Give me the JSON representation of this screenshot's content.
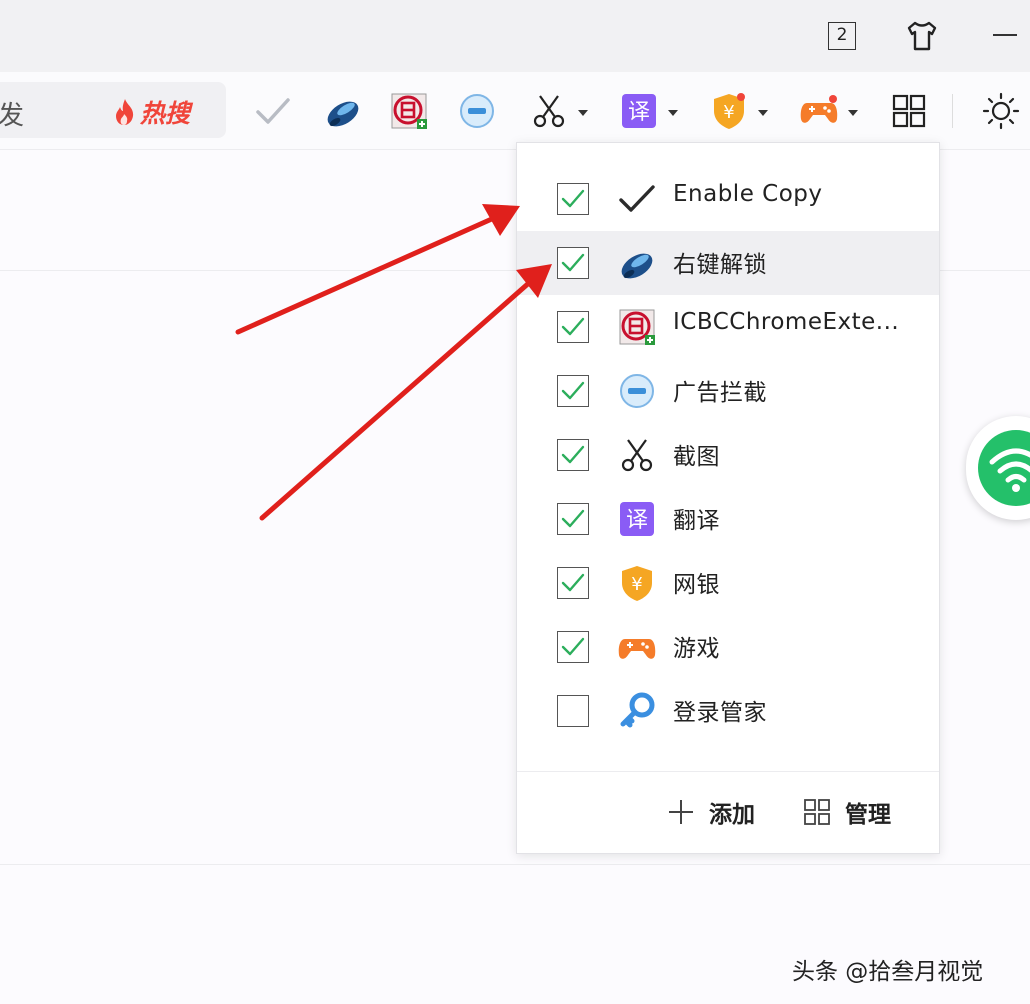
{
  "titlebar": {
    "tab_count": "2"
  },
  "toolbar": {
    "search_text": "发",
    "hot_search_label": "热搜"
  },
  "dropdown": {
    "items": [
      {
        "label": "Enable Copy",
        "checked": true,
        "icon": "checkmark-icon"
      },
      {
        "label": "右键解锁",
        "checked": true,
        "icon": "blue-mouse-icon"
      },
      {
        "label": "ICBCChromeExte...",
        "checked": true,
        "icon": "icbc-logo-icon"
      },
      {
        "label": "广告拦截",
        "checked": true,
        "icon": "ad-block-icon"
      },
      {
        "label": "截图",
        "checked": true,
        "icon": "scissors-icon"
      },
      {
        "label": "翻译",
        "checked": true,
        "icon": "translate-icon"
      },
      {
        "label": "网银",
        "checked": true,
        "icon": "online-bank-shield-icon"
      },
      {
        "label": "游戏",
        "checked": true,
        "icon": "gamepad-icon"
      },
      {
        "label": "登录管家",
        "checked": false,
        "icon": "key-icon"
      }
    ],
    "add_label": "添加",
    "manage_label": "管理"
  },
  "watermark": "头条 @拾叁月视觉",
  "colors": {
    "check_green": "#2cae5c",
    "arrow_red": "#e0201c",
    "hot_red": "#f0453a",
    "wifi_green": "#24c06a",
    "translate_purple": "#8a5cf5",
    "bank_orange": "#f5a623",
    "game_orange": "#f57c2a"
  }
}
